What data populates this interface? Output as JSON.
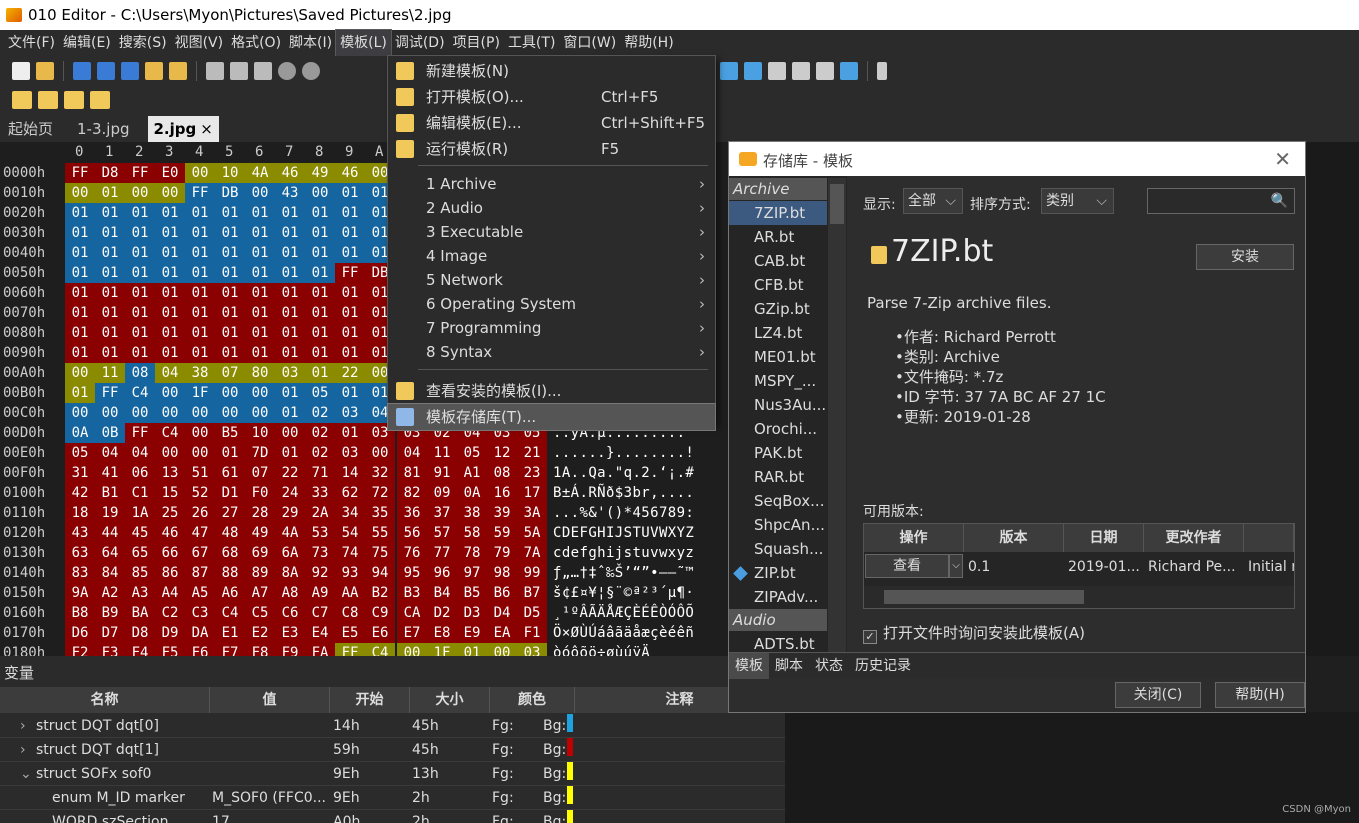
{
  "window": {
    "title": "010 Editor - C:\\Users\\Myon\\Pictures\\Saved Pictures\\2.jpg"
  },
  "menubar": [
    "文件(F)",
    "编辑(E)",
    "搜索(S)",
    "视图(V)",
    "格式(O)",
    "脚本(I)",
    "模板(L)",
    "调试(D)",
    "项目(P)",
    "工具(T)",
    "窗口(W)",
    "帮助(H)"
  ],
  "tabs": [
    "起始页",
    "1-3.jpg",
    "2.jpg"
  ],
  "tab_close": "×",
  "hex": {
    "header": [
      "0",
      "1",
      "2",
      "3",
      "4",
      "5",
      "6",
      "7",
      "8",
      "9",
      "A"
    ],
    "rows": [
      {
        "off": "0000h",
        "bytes": [
          "FF",
          "D8",
          "FF",
          "E0",
          "00",
          "10",
          "4A",
          "46",
          "49",
          "46",
          "00"
        ],
        "ascii": ""
      },
      {
        "off": "0010h",
        "bytes": [
          "00",
          "01",
          "00",
          "00",
          "FF",
          "DB",
          "00",
          "43",
          "00",
          "01",
          "01"
        ],
        "ascii": ""
      },
      {
        "off": "0020h",
        "bytes": [
          "01",
          "01",
          "01",
          "01",
          "01",
          "01",
          "01",
          "01",
          "01",
          "01",
          "01"
        ],
        "ascii": ""
      },
      {
        "off": "0030h",
        "bytes": [
          "01",
          "01",
          "01",
          "01",
          "01",
          "01",
          "01",
          "01",
          "01",
          "01",
          "01"
        ],
        "ascii": ""
      },
      {
        "off": "0040h",
        "bytes": [
          "01",
          "01",
          "01",
          "01",
          "01",
          "01",
          "01",
          "01",
          "01",
          "01",
          "01"
        ],
        "ascii": ""
      },
      {
        "off": "0050h",
        "bytes": [
          "01",
          "01",
          "01",
          "01",
          "01",
          "01",
          "01",
          "01",
          "01",
          "FF",
          "DB"
        ],
        "ascii": ""
      },
      {
        "off": "0060h",
        "bytes": [
          "01",
          "01",
          "01",
          "01",
          "01",
          "01",
          "01",
          "01",
          "01",
          "01",
          "01"
        ],
        "ascii": ""
      },
      {
        "off": "0070h",
        "bytes": [
          "01",
          "01",
          "01",
          "01",
          "01",
          "01",
          "01",
          "01",
          "01",
          "01",
          "01"
        ],
        "ascii": ""
      },
      {
        "off": "0080h",
        "bytes": [
          "01",
          "01",
          "01",
          "01",
          "01",
          "01",
          "01",
          "01",
          "01",
          "01",
          "01"
        ],
        "ascii": ""
      },
      {
        "off": "0090h",
        "bytes": [
          "01",
          "01",
          "01",
          "01",
          "01",
          "01",
          "01",
          "01",
          "01",
          "01",
          "01"
        ],
        "ascii": ""
      },
      {
        "off": "00A0h",
        "bytes": [
          "00",
          "11",
          "08",
          "04",
          "38",
          "07",
          "80",
          "03",
          "01",
          "22",
          "00"
        ],
        "ascii": ""
      },
      {
        "off": "00B0h",
        "bytes": [
          "01",
          "FF",
          "C4",
          "00",
          "1F",
          "00",
          "00",
          "01",
          "05",
          "01",
          "01"
        ],
        "ascii": ""
      },
      {
        "off": "00C0h",
        "bytes": [
          "00",
          "00",
          "00",
          "00",
          "00",
          "00",
          "00",
          "01",
          "02",
          "03",
          "04"
        ],
        "ascii": ""
      },
      {
        "off": "00D0h",
        "bytes": [
          "0A",
          "0B",
          "FF",
          "C4",
          "00",
          "B5",
          "10",
          "00",
          "02",
          "01",
          "03",
          "03",
          "02",
          "04",
          "03",
          "05"
        ],
        "ascii": "..ÿÄ.µ........."
      },
      {
        "off": "00E0h",
        "bytes": [
          "05",
          "04",
          "04",
          "00",
          "00",
          "01",
          "7D",
          "01",
          "02",
          "03",
          "00",
          "04",
          "11",
          "05",
          "12",
          "21"
        ],
        "ascii": "......}........!"
      },
      {
        "off": "00F0h",
        "bytes": [
          "31",
          "41",
          "06",
          "13",
          "51",
          "61",
          "07",
          "22",
          "71",
          "14",
          "32",
          "81",
          "91",
          "A1",
          "08",
          "23"
        ],
        "ascii": "1A..Qa.\"q.2.‘¡.#"
      },
      {
        "off": "0100h",
        "bytes": [
          "42",
          "B1",
          "C1",
          "15",
          "52",
          "D1",
          "F0",
          "24",
          "33",
          "62",
          "72",
          "82",
          "09",
          "0A",
          "16",
          "17"
        ],
        "ascii": "B±Á.RÑð$3br,...."
      },
      {
        "off": "0110h",
        "bytes": [
          "18",
          "19",
          "1A",
          "25",
          "26",
          "27",
          "28",
          "29",
          "2A",
          "34",
          "35",
          "36",
          "37",
          "38",
          "39",
          "3A"
        ],
        "ascii": "...%&'()*456789:"
      },
      {
        "off": "0120h",
        "bytes": [
          "43",
          "44",
          "45",
          "46",
          "47",
          "48",
          "49",
          "4A",
          "53",
          "54",
          "55",
          "56",
          "57",
          "58",
          "59",
          "5A"
        ],
        "ascii": "CDEFGHIJSTUVWXYZ"
      },
      {
        "off": "0130h",
        "bytes": [
          "63",
          "64",
          "65",
          "66",
          "67",
          "68",
          "69",
          "6A",
          "73",
          "74",
          "75",
          "76",
          "77",
          "78",
          "79",
          "7A"
        ],
        "ascii": "cdefghijstuvwxyz"
      },
      {
        "off": "0140h",
        "bytes": [
          "83",
          "84",
          "85",
          "86",
          "87",
          "88",
          "89",
          "8A",
          "92",
          "93",
          "94",
          "95",
          "96",
          "97",
          "98",
          "99"
        ],
        "ascii": "ƒ„…†‡ˆ‰Š’“”•–—˜™"
      },
      {
        "off": "0150h",
        "bytes": [
          "9A",
          "A2",
          "A3",
          "A4",
          "A5",
          "A6",
          "A7",
          "A8",
          "A9",
          "AA",
          "B2",
          "B3",
          "B4",
          "B5",
          "B6",
          "B7"
        ],
        "ascii": "š¢£¤¥¦§¨©ª²³´µ¶·"
      },
      {
        "off": "0160h",
        "bytes": [
          "B8",
          "B9",
          "BA",
          "C2",
          "C3",
          "C4",
          "C5",
          "C6",
          "C7",
          "C8",
          "C9",
          "CA",
          "D2",
          "D3",
          "D4",
          "D5"
        ],
        "ascii": "¸¹ºÂÃÄÅÆÇÈÉÊÒÓÔÕ"
      },
      {
        "off": "0170h",
        "bytes": [
          "D6",
          "D7",
          "D8",
          "D9",
          "DA",
          "E1",
          "E2",
          "E3",
          "E4",
          "E5",
          "E6",
          "E7",
          "E8",
          "E9",
          "EA",
          "F1"
        ],
        "ascii": "Ö×ØÙÚáâãäåæçèéêñ"
      },
      {
        "off": "0180h",
        "bytes": [
          "F2",
          "F3",
          "F4",
          "F5",
          "F6",
          "F7",
          "F8",
          "F9",
          "FA",
          "FF",
          "C4",
          "00",
          "1F",
          "01",
          "00",
          "03"
        ],
        "ascii": "òóôõö÷øùúÿÄ"
      }
    ]
  },
  "template_menu": {
    "items": [
      {
        "label": "新建模板(N)",
        "shortcut": ""
      },
      {
        "label": "打开模板(O)...",
        "shortcut": "Ctrl+F5"
      },
      {
        "label": "编辑模板(E)...",
        "shortcut": "Ctrl+Shift+F5"
      },
      {
        "label": "运行模板(R)",
        "shortcut": "F5"
      }
    ],
    "categories": [
      "1 Archive",
      "2 Audio",
      "3 Executable",
      "4 Image",
      "5 Network",
      "6 Operating System",
      "7 Programming",
      "8 Syntax"
    ],
    "submenu_arrow": "›",
    "view_installed": "查看安装的模板(I)...",
    "repository": "模板存储库(T)..."
  },
  "dialog": {
    "title": "存储库 - 模板",
    "close_glyph": "✕",
    "list": {
      "group_archive": "Archive",
      "archive_items": [
        "7ZIP.bt",
        "AR.bt",
        "CAB.bt",
        "CFB.bt",
        "GZip.bt",
        "LZ4.bt",
        "ME01.bt",
        "MSPY_...",
        "Nus3Au...",
        "Orochi...",
        "PAK.bt",
        "RAR.bt",
        "SeqBox...",
        "ShpcAn...",
        "Squash...",
        "ZIP.bt",
        "ZIPAdv..."
      ],
      "group_audio": "Audio",
      "audio_items": [
        "ADTS.bt"
      ]
    },
    "filter": {
      "show_label": "显示:",
      "show_value": "全部",
      "sort_label": "排序方式:",
      "sort_value": "类别",
      "dropdown_arrow": "⌵",
      "search_glyph": "🔍"
    },
    "detail": {
      "name": "7ZIP.bt",
      "install": "安装",
      "description": "Parse 7-Zip archive files.",
      "bullets": [
        "作者: Richard Perrott",
        "类别: Archive",
        "文件掩码: *.7z",
        "ID 字节: 37 7A BC AF 27 1C",
        "更新: 2019-01-28"
      ]
    },
    "versions": {
      "label": "可用版本:",
      "columns": [
        "操作",
        "版本",
        "日期",
        "更改作者",
        ""
      ],
      "row": {
        "action": "查看",
        "version": "0.1",
        "date": "2019-01...",
        "author": "Richard Pe...",
        "notes": "Initial r"
      }
    },
    "checkbox": {
      "label": "打开文件时询问安装此模板(A)",
      "checked": true,
      "mark": "✓"
    },
    "tabs": [
      "模板",
      "脚本",
      "状态",
      "历史记录"
    ],
    "close_btn": "关闭(C)",
    "help_btn": "帮助(H)"
  },
  "variables": {
    "title": "变量",
    "columns": [
      "名称",
      "值",
      "开始",
      "大小",
      "颜色",
      "注释"
    ],
    "rows": [
      {
        "name": "struct DQT dqt[0]",
        "value": "",
        "start": "14h",
        "size": "45h",
        "fg": "Fg:",
        "bg": "Bg:",
        "swatch": "#1fa3e0",
        "expand": "›"
      },
      {
        "name": "struct DQT dqt[1]",
        "value": "",
        "start": "59h",
        "size": "45h",
        "fg": "Fg:",
        "bg": "Bg:",
        "swatch": "#c00000",
        "expand": "›"
      },
      {
        "name": "struct SOFx sof0",
        "value": "",
        "start": "9Eh",
        "size": "13h",
        "fg": "Fg:",
        "bg": "Bg:",
        "swatch": "#ffff00",
        "expand": "⌄"
      },
      {
        "name": "enum M_ID marker",
        "value": "M_SOF0 (FFC0...",
        "start": "9Eh",
        "size": "2h",
        "fg": "Fg:",
        "bg": "Bg:",
        "swatch": "#ffff00",
        "expand": ""
      },
      {
        "name": "WORD szSection",
        "value": "17",
        "start": "A0h",
        "size": "2h",
        "fg": "Fg:",
        "bg": "Bg:",
        "swatch": "#ffff00",
        "expand": ""
      }
    ]
  },
  "watermark": "CSDN @Myon⁠"
}
